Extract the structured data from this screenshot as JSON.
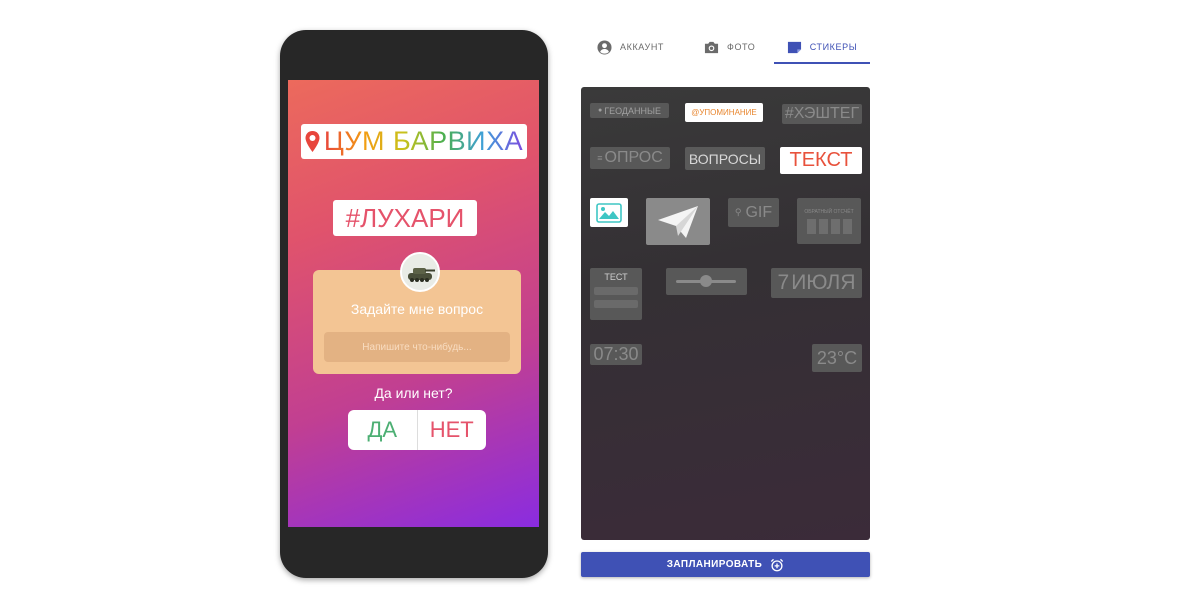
{
  "preview": {
    "location_sticker": "ЦУМ БАРВИХА",
    "hashtag_sticker": "#ЛУХАРИ",
    "question_sticker": {
      "title": "Задайте мне вопрос",
      "placeholder": "Напишите что-нибудь..."
    },
    "poll_sticker": {
      "question": "Да или нет?",
      "yes": "ДА",
      "no": "НЕТ"
    }
  },
  "tabs": [
    {
      "label": "АККАУНТ",
      "icon": "account-icon"
    },
    {
      "label": "ФОТО",
      "icon": "camera-icon"
    },
    {
      "label": "СТИКЕРЫ",
      "icon": "sticker-icon",
      "active": true
    }
  ],
  "sticker_panel": {
    "geo": "ГЕОДАННЫЕ",
    "mention": "@УПОМИНАНИЕ",
    "hashtag": "#ХЭШТЕГ",
    "poll": "ОПРОС",
    "questions": "ВОПРОСЫ",
    "text": "ТЕКСТ",
    "gif": "GIF",
    "countdown": "ОБРАТНЫЙ ОТСЧЁТ",
    "quiz": "ТЕСТ",
    "date_day": "7",
    "date_month": "ИЮЛЯ",
    "time": "07:30",
    "temperature": "23°C"
  },
  "actions": {
    "schedule_label": "ЗАПЛАНИРОВАТЬ"
  },
  "colors": {
    "accent": "#3f51b5",
    "phone_frame": "#272727",
    "panel_bg": "#363236"
  }
}
